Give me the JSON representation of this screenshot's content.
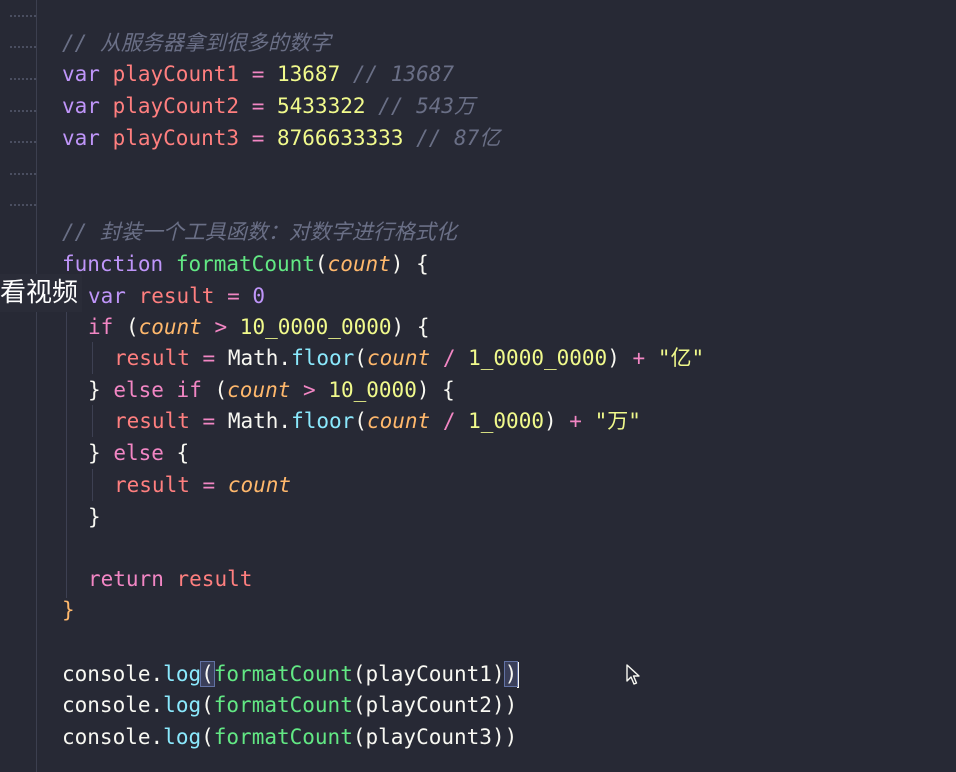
{
  "code": {
    "comment1": "// 从服务器拿到很多的数字",
    "line_var1": {
      "kw": "var",
      "name": "playCount1",
      "eq": "=",
      "value": "13687",
      "comment": "// 13687"
    },
    "line_var2": {
      "kw": "var",
      "name": "playCount2",
      "eq": "=",
      "value": "5433322",
      "comment": "// 543万"
    },
    "line_var3": {
      "kw": "var",
      "name": "playCount3",
      "eq": "=",
      "value": "8766633333",
      "comment": "// 87亿"
    },
    "comment2": "// 封装一个工具函数：对数字进行格式化",
    "fn_decl": {
      "kw": "function",
      "name": "formatCount",
      "open": "(",
      "param": "count",
      "close": ")",
      "brace": "{"
    },
    "result_decl": {
      "kw": "var",
      "name": "result",
      "eq": "=",
      "value": "0"
    },
    "if_line": {
      "kw": "if",
      "open": "(",
      "param": "count",
      "op": ">",
      "value": "10_0000_0000",
      "close": ")",
      "brace": "{"
    },
    "assign1": {
      "name": "result",
      "eq": "=",
      "obj": "Math",
      "dot": ".",
      "method": "floor",
      "open": "(",
      "param": "count",
      "op": "/",
      "value": "1_0000_0000",
      "close": ")",
      "plus": "+",
      "str": "\"亿\""
    },
    "elseif_line": {
      "brace_close": "}",
      "kw_else": "else",
      "kw_if": "if",
      "open": "(",
      "param": "count",
      "op": ">",
      "value": "10_0000",
      "close": ")",
      "brace": "{"
    },
    "assign2": {
      "name": "result",
      "eq": "=",
      "obj": "Math",
      "dot": ".",
      "method": "floor",
      "open": "(",
      "param": "count",
      "op": "/",
      "value": "1_0000",
      "close": ")",
      "plus": "+",
      "str": "\"万\""
    },
    "else_line": {
      "brace_close": "}",
      "kw": "else",
      "brace": "{"
    },
    "assign3": {
      "name": "result",
      "eq": "=",
      "param": "count"
    },
    "inner_close": "}",
    "return_line": {
      "kw": "return",
      "name": "result"
    },
    "fn_close": "}",
    "log1": {
      "obj": "console",
      "dot": ".",
      "method": "log",
      "open": "(",
      "fn": "formatCount",
      "open2": "(",
      "arg": "playCount1",
      "close2": ")",
      "close": ")"
    },
    "log2": {
      "obj": "console",
      "dot": ".",
      "method": "log",
      "open": "(",
      "fn": "formatCount",
      "open2": "(",
      "arg": "playCount2",
      "close2": ")",
      "close": ")"
    },
    "log3": {
      "obj": "console",
      "dot": ".",
      "method": "log",
      "open": "(",
      "fn": "formatCount",
      "open2": "(",
      "arg": "playCount3",
      "close2": ")",
      "close": ")"
    }
  },
  "overlay": {
    "text": "看视频"
  },
  "icons": {
    "cursor": "mouse-pointer-icon"
  }
}
